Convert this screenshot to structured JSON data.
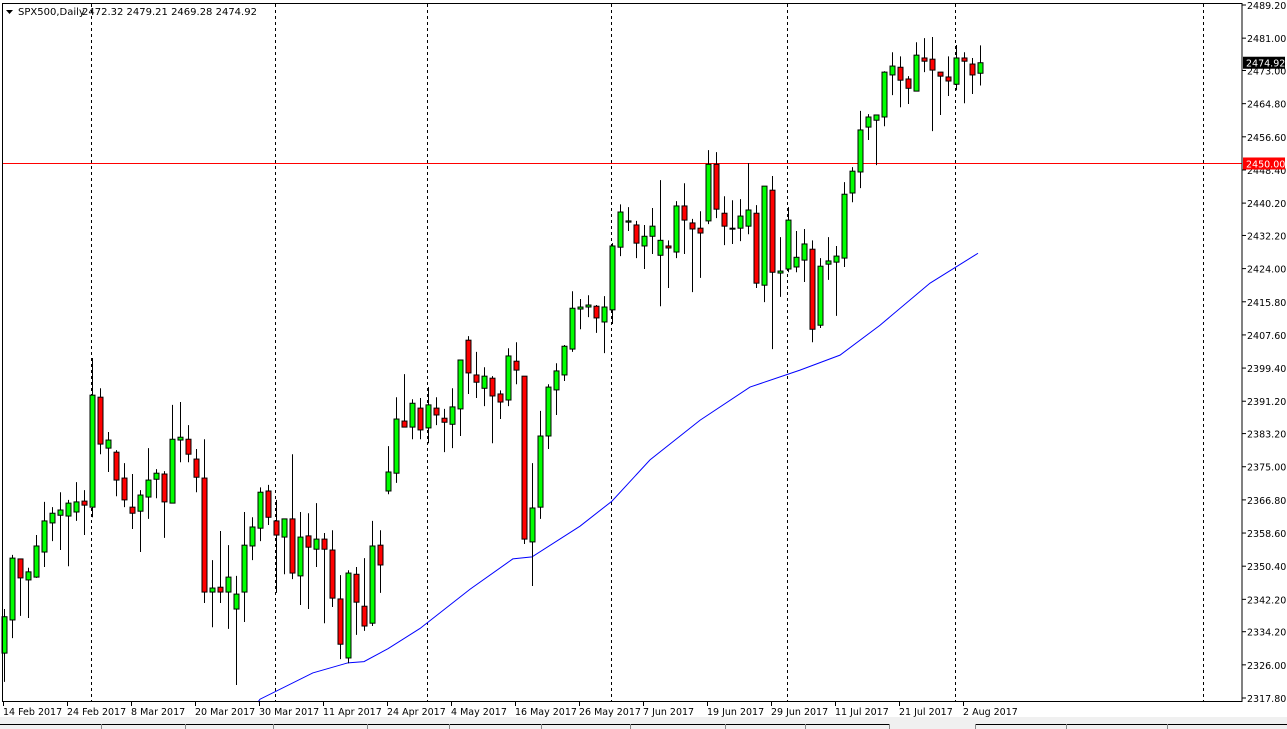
{
  "chart_data": {
    "type": "candlestick",
    "title": "SPX500,Daily",
    "header_ohlc": "2472.32 2479.21 2469.28 2474.92",
    "ylim": [
      2317.8,
      2489.2
    ],
    "y_ticks": [
      "2489.20",
      "2481.00",
      "2473.00",
      "2464.80",
      "2456.60",
      "2448.40",
      "2440.20",
      "2432.20",
      "2424.00",
      "2415.80",
      "2407.60",
      "2399.40",
      "2391.20",
      "2383.20",
      "2375.00",
      "2366.80",
      "2358.60",
      "2350.40",
      "2342.20",
      "2334.20",
      "2326.00",
      "2317.80"
    ],
    "x_labels": [
      {
        "label": "14 Feb 2017",
        "index": 0
      },
      {
        "label": "24 Feb 2017",
        "index": 8
      },
      {
        "label": "8 Mar 2017",
        "index": 16
      },
      {
        "label": "20 Mar 2017",
        "index": 24
      },
      {
        "label": "30 Mar 2017",
        "index": 32
      },
      {
        "label": "11 Apr 2017",
        "index": 40
      },
      {
        "label": "24 Apr 2017",
        "index": 48
      },
      {
        "label": "4 May 2017",
        "index": 56
      },
      {
        "label": "16 May 2017",
        "index": 64
      },
      {
        "label": "26 May 2017",
        "index": 72
      },
      {
        "label": "7 Jun 2017",
        "index": 80
      },
      {
        "label": "19 Jun 2017",
        "index": 88
      },
      {
        "label": "29 Jun 2017",
        "index": 96
      },
      {
        "label": "11 Jul 2017",
        "index": 104
      },
      {
        "label": "21 Jul 2017",
        "index": 112
      },
      {
        "label": "2 Aug 2017",
        "index": 120
      }
    ],
    "period_separators": [
      11,
      34,
      53,
      76,
      98,
      119,
      150
    ],
    "candles_ohlc": [
      [
        2328.9,
        2339.8,
        2321.8,
        2337.9
      ],
      [
        2337.1,
        2353.2,
        2332.6,
        2352.4
      ],
      [
        2352.2,
        2352.2,
        2338.1,
        2347.5
      ],
      [
        2347.0,
        2350.0,
        2337.6,
        2349.0
      ],
      [
        2347.7,
        2358.1,
        2347.5,
        2355.4
      ],
      [
        2353.9,
        2366.3,
        2350.2,
        2361.6
      ],
      [
        2361.1,
        2365.0,
        2356.6,
        2363.5
      ],
      [
        2363.0,
        2368.7,
        2354.4,
        2364.3
      ],
      [
        2362.8,
        2366.8,
        2350.4,
        2366.0
      ],
      [
        2363.8,
        2371.2,
        2361.6,
        2366.3
      ],
      [
        2366.5,
        2369.2,
        2358.1,
        2365.5
      ],
      [
        2365.0,
        2401.9,
        2362.5,
        2392.7
      ],
      [
        2392.2,
        2394.4,
        2378.1,
        2380.6
      ],
      [
        2379.6,
        2383.6,
        2373.7,
        2381.6
      ],
      [
        2378.6,
        2379.1,
        2367.7,
        2371.7
      ],
      [
        2372.2,
        2375.9,
        2365.0,
        2366.8
      ],
      [
        2365.0,
        2373.2,
        2359.6,
        2363.5
      ],
      [
        2364.0,
        2369.2,
        2353.9,
        2368.0
      ],
      [
        2367.5,
        2379.6,
        2362.1,
        2371.7
      ],
      [
        2371.9,
        2374.4,
        2367.2,
        2373.4
      ],
      [
        2373.2,
        2373.9,
        2357.4,
        2366.3
      ],
      [
        2366.0,
        2390.3,
        2366.0,
        2381.8
      ],
      [
        2381.6,
        2391.0,
        2376.1,
        2382.3
      ],
      [
        2381.8,
        2385.3,
        2376.1,
        2378.1
      ],
      [
        2376.9,
        2379.4,
        2368.7,
        2372.4
      ],
      [
        2372.2,
        2381.8,
        2341.3,
        2344.0
      ],
      [
        2344.0,
        2351.9,
        2335.3,
        2345.0
      ],
      [
        2345.2,
        2359.1,
        2341.3,
        2344.0
      ],
      [
        2344.0,
        2355.6,
        2334.9,
        2347.7
      ],
      [
        2339.8,
        2348.0,
        2321.0,
        2343.5
      ],
      [
        2344.0,
        2363.8,
        2336.6,
        2355.6
      ],
      [
        2355.4,
        2362.5,
        2351.9,
        2360.1
      ],
      [
        2359.8,
        2369.9,
        2356.6,
        2368.7
      ],
      [
        2369.0,
        2370.5,
        2360.6,
        2362.5
      ],
      [
        2361.6,
        2366.8,
        2343.8,
        2358.1
      ],
      [
        2357.6,
        2362.1,
        2348.4,
        2362.1
      ],
      [
        2362.1,
        2378.1,
        2347.2,
        2348.7
      ],
      [
        2348.0,
        2363.8,
        2340.8,
        2357.6
      ],
      [
        2357.9,
        2363.5,
        2339.8,
        2355.1
      ],
      [
        2354.6,
        2366.0,
        2350.2,
        2357.1
      ],
      [
        2357.1,
        2358.6,
        2336.3,
        2354.6
      ],
      [
        2354.4,
        2359.3,
        2340.3,
        2342.5
      ],
      [
        2342.3,
        2348.2,
        2327.4,
        2331.1
      ],
      [
        2327.7,
        2349.4,
        2326.4,
        2348.7
      ],
      [
        2348.4,
        2350.2,
        2333.4,
        2341.5
      ],
      [
        2340.5,
        2352.4,
        2334.4,
        2335.6
      ],
      [
        2336.3,
        2361.6,
        2335.6,
        2355.4
      ],
      [
        2355.6,
        2359.3,
        2343.8,
        2350.7
      ],
      [
        2369.0,
        2380.1,
        2368.2,
        2373.7
      ],
      [
        2373.4,
        2392.2,
        2371.0,
        2386.8
      ],
      [
        2386.3,
        2397.9,
        2384.8,
        2384.8
      ],
      [
        2384.8,
        2391.7,
        2381.8,
        2390.7
      ],
      [
        2389.5,
        2392.0,
        2381.8,
        2384.1
      ],
      [
        2384.6,
        2394.7,
        2380.8,
        2390.3
      ],
      [
        2389.5,
        2392.2,
        2385.3,
        2387.8
      ],
      [
        2387.0,
        2389.3,
        2378.6,
        2386.0
      ],
      [
        2385.5,
        2394.4,
        2379.6,
        2389.8
      ],
      [
        2389.3,
        2401.4,
        2382.6,
        2401.4
      ],
      [
        2406.3,
        2407.3,
        2393.0,
        2398.2
      ],
      [
        2397.7,
        2403.4,
        2392.0,
        2395.9
      ],
      [
        2394.4,
        2399.6,
        2390.0,
        2397.4
      ],
      [
        2396.9,
        2397.4,
        2380.8,
        2392.5
      ],
      [
        2393.0,
        2393.9,
        2386.8,
        2391.0
      ],
      [
        2391.5,
        2404.3,
        2390.0,
        2402.4
      ],
      [
        2401.1,
        2405.8,
        2395.4,
        2398.9
      ],
      [
        2397.4,
        2397.4,
        2355.9,
        2357.1
      ],
      [
        2356.4,
        2375.9,
        2345.5,
        2364.8
      ],
      [
        2365.0,
        2388.8,
        2362.1,
        2382.6
      ],
      [
        2382.6,
        2395.4,
        2379.4,
        2394.7
      ],
      [
        2394.0,
        2400.6,
        2387.8,
        2398.7
      ],
      [
        2397.7,
        2405.1,
        2396.2,
        2404.8
      ],
      [
        2404.1,
        2418.4,
        2403.4,
        2414.2
      ],
      [
        2414.0,
        2416.5,
        2409.0,
        2414.5
      ],
      [
        2414.5,
        2417.4,
        2412.0,
        2415.0
      ],
      [
        2414.7,
        2415.0,
        2408.1,
        2411.8
      ],
      [
        2410.8,
        2417.2,
        2403.1,
        2414.5
      ],
      [
        2413.8,
        2430.3,
        2410.3,
        2429.6
      ],
      [
        2429.3,
        2439.9,
        2427.1,
        2438.0
      ],
      [
        2435.5,
        2439.2,
        2433.3,
        2435.8
      ],
      [
        2434.8,
        2435.8,
        2426.6,
        2430.3
      ],
      [
        2429.6,
        2434.8,
        2423.9,
        2432.0
      ],
      [
        2432.0,
        2439.0,
        2427.6,
        2434.5
      ],
      [
        2427.3,
        2445.9,
        2414.7,
        2431.0
      ],
      [
        2429.6,
        2431.0,
        2419.2,
        2429.1
      ],
      [
        2428.1,
        2440.7,
        2426.6,
        2439.5
      ],
      [
        2439.5,
        2445.1,
        2427.6,
        2436.0
      ],
      [
        2435.3,
        2436.3,
        2418.2,
        2433.8
      ],
      [
        2434.0,
        2438.2,
        2421.7,
        2432.8
      ],
      [
        2435.8,
        2453.3,
        2435.0,
        2449.8
      ],
      [
        2449.8,
        2452.8,
        2436.5,
        2438.7
      ],
      [
        2437.7,
        2441.9,
        2429.8,
        2434.5
      ],
      [
        2433.9,
        2440.9,
        2430.1,
        2434.0
      ],
      [
        2434.0,
        2441.2,
        2430.8,
        2437.0
      ],
      [
        2434.5,
        2450.1,
        2432.5,
        2438.5
      ],
      [
        2437.7,
        2439.7,
        2419.2,
        2420.4
      ],
      [
        2419.9,
        2444.4,
        2415.7,
        2444.4
      ],
      [
        2443.4,
        2446.9,
        2404.1,
        2423.1
      ],
      [
        2422.9,
        2431.8,
        2417.0,
        2423.4
      ],
      [
        2423.9,
        2439.2,
        2423.1,
        2436.0
      ],
      [
        2424.4,
        2433.3,
        2423.1,
        2426.8
      ],
      [
        2426.1,
        2433.8,
        2420.7,
        2430.1
      ],
      [
        2428.8,
        2431.0,
        2405.8,
        2409.0
      ],
      [
        2410.0,
        2426.6,
        2409.3,
        2424.6
      ],
      [
        2425.1,
        2431.8,
        2421.2,
        2425.9
      ],
      [
        2425.6,
        2429.6,
        2412.3,
        2427.1
      ],
      [
        2426.6,
        2445.4,
        2424.4,
        2442.4
      ],
      [
        2442.7,
        2449.1,
        2440.4,
        2448.1
      ],
      [
        2447.9,
        2463.0,
        2443.9,
        2458.3
      ],
      [
        2459.0,
        2462.2,
        2455.8,
        2461.5
      ],
      [
        2460.7,
        2462.0,
        2449.6,
        2462.0
      ],
      [
        2461.5,
        2472.8,
        2459.2,
        2472.6
      ],
      [
        2471.9,
        2477.5,
        2466.9,
        2474.1
      ],
      [
        2473.8,
        2476.5,
        2463.9,
        2470.6
      ],
      [
        2470.9,
        2471.6,
        2464.7,
        2468.6
      ],
      [
        2467.9,
        2480.0,
        2467.9,
        2476.8
      ],
      [
        2476.1,
        2481.0,
        2472.6,
        2475.3
      ],
      [
        2475.8,
        2481.3,
        2458.0,
        2473.1
      ],
      [
        2472.6,
        2472.6,
        2462.0,
        2471.6
      ],
      [
        2471.4,
        2476.5,
        2466.7,
        2470.4
      ],
      [
        2469.6,
        2479.3,
        2468.1,
        2476.1
      ],
      [
        2476.1,
        2477.5,
        2464.9,
        2475.3
      ],
      [
        2474.6,
        2476.1,
        2467.2,
        2471.9
      ],
      [
        2472.32,
        2479.21,
        2469.28,
        2474.92
      ]
    ],
    "moving_average": [
      [
        31.75,
        2316.8
      ],
      [
        32,
        2317.5
      ],
      [
        38.6,
        2324.0
      ],
      [
        43,
        2326.5
      ],
      [
        45,
        2326.8
      ],
      [
        48,
        2330.0
      ],
      [
        52,
        2335.0
      ],
      [
        58.25,
        2344.7
      ],
      [
        63.6,
        2352.2
      ],
      [
        66,
        2352.7
      ],
      [
        72,
        2360.3
      ],
      [
        76,
        2366.5
      ],
      [
        80.75,
        2376.7
      ],
      [
        87,
        2386.5
      ],
      [
        93.25,
        2394.7
      ],
      [
        99.5,
        2398.9
      ],
      [
        104.5,
        2402.6
      ],
      [
        109.5,
        2410.0
      ],
      [
        115.75,
        2420.4
      ],
      [
        121.75,
        2427.8
      ]
    ],
    "horizontal_line": {
      "value": 2450.0,
      "label": "2450.00"
    },
    "current_price": {
      "value": 2474.92,
      "label": "2474.92"
    },
    "colors": {
      "bull": "#00ff00",
      "bear": "#ff0000",
      "ma": "#0000ff",
      "hline": "#ff0000"
    }
  }
}
